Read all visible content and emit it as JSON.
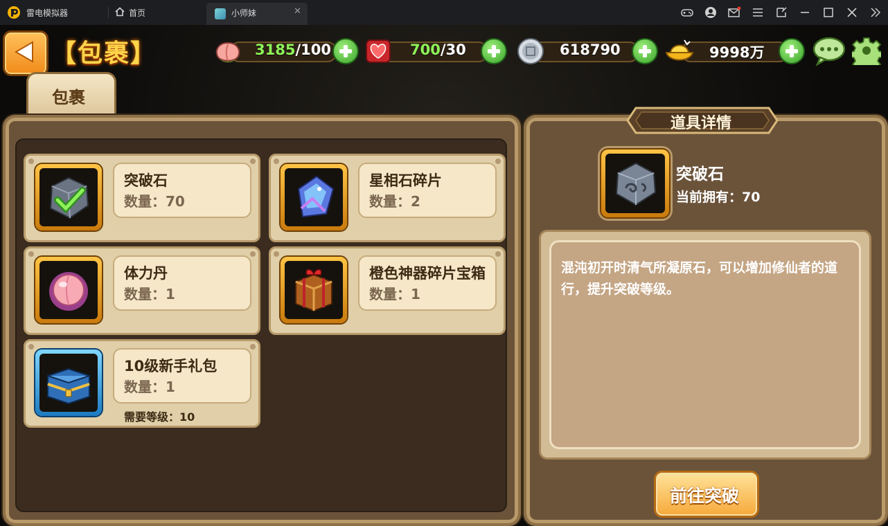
{
  "emulator": {
    "app_name": "雷电模拟器",
    "home_label": "首页",
    "tab_label": "小师妹",
    "tab_close": "✕"
  },
  "game": {
    "page_title": "【包裹】",
    "tab_label": "包裹",
    "resources": {
      "stamina": {
        "current": "3185",
        "max": "/100"
      },
      "hearts": {
        "current": "700",
        "max": "/30"
      },
      "silver": {
        "value": "618790"
      },
      "gold": {
        "value": "9998万"
      }
    },
    "items": [
      {
        "name": "突破石",
        "qty": "数量：70",
        "frame": "gold",
        "icon": "breakthrough-stone-icon"
      },
      {
        "name": "星相石碎片",
        "qty": "数量：2",
        "frame": "gold",
        "icon": "star-stone-fragment-icon"
      },
      {
        "name": "体力丹",
        "qty": "数量：1",
        "frame": "gold",
        "icon": "stamina-pill-icon"
      },
      {
        "name": "橙色神器碎片宝箱",
        "qty": "数量：1",
        "frame": "gold",
        "icon": "gift-chest-icon"
      },
      {
        "name": "10级新手礼包",
        "qty": "数量：1",
        "frame": "blue",
        "icon": "newbie-chest-icon",
        "requirement": "需要等级：10"
      }
    ],
    "detail": {
      "title": "道具详情",
      "name": "突破石",
      "owned": "当前拥有：70",
      "description": "混沌初开时清气所凝原石，可以增加修仙者的道行，提升突破等级。",
      "action_label": "前往突破"
    }
  },
  "colors": {
    "titlebar_bg": "#1d1e21",
    "panel_brown": "#6b533a",
    "card_bg": "#e0cfa9",
    "gold_frame": "#ffc445",
    "plus_green": "#36a12a",
    "title_yellow": "#ffd54a"
  }
}
